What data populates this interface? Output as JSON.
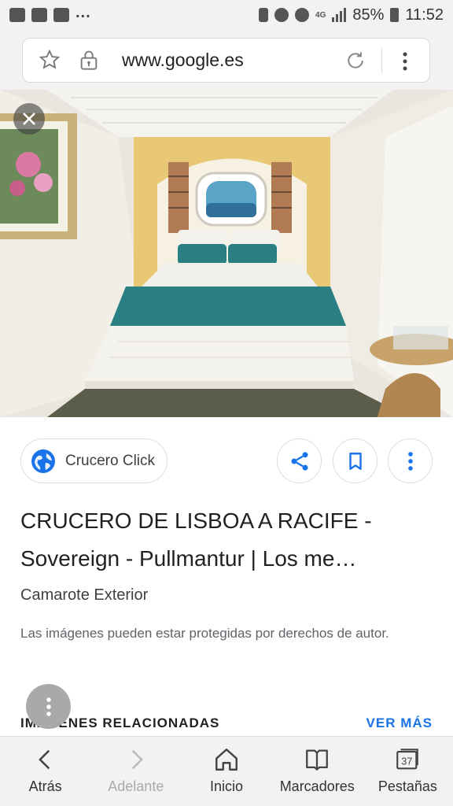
{
  "status_bar": {
    "network": "4G",
    "battery": "85%",
    "time": "11:52",
    "dots": "..."
  },
  "browser": {
    "url": "www.google.es"
  },
  "result": {
    "source_name": "Crucero Click",
    "title": "CRUCERO DE LISBOA A RACIFE - Sovereign - Pullmantur | Los me…",
    "subtitle": "Camarote Exterior",
    "notice": "Las imágenes pueden estar protegidas por derechos de autor."
  },
  "related": {
    "heading": "IMÁGENES RELACIONADAS",
    "see_more": "VER MÁS"
  },
  "bottom_nav": {
    "back": "Atrás",
    "forward": "Adelante",
    "home": "Inicio",
    "bookmarks": "Marcadores",
    "tabs": "Pestañas",
    "tab_count": "37"
  },
  "colors": {
    "accent": "#1a73e8",
    "teal": "#2a7f83"
  }
}
